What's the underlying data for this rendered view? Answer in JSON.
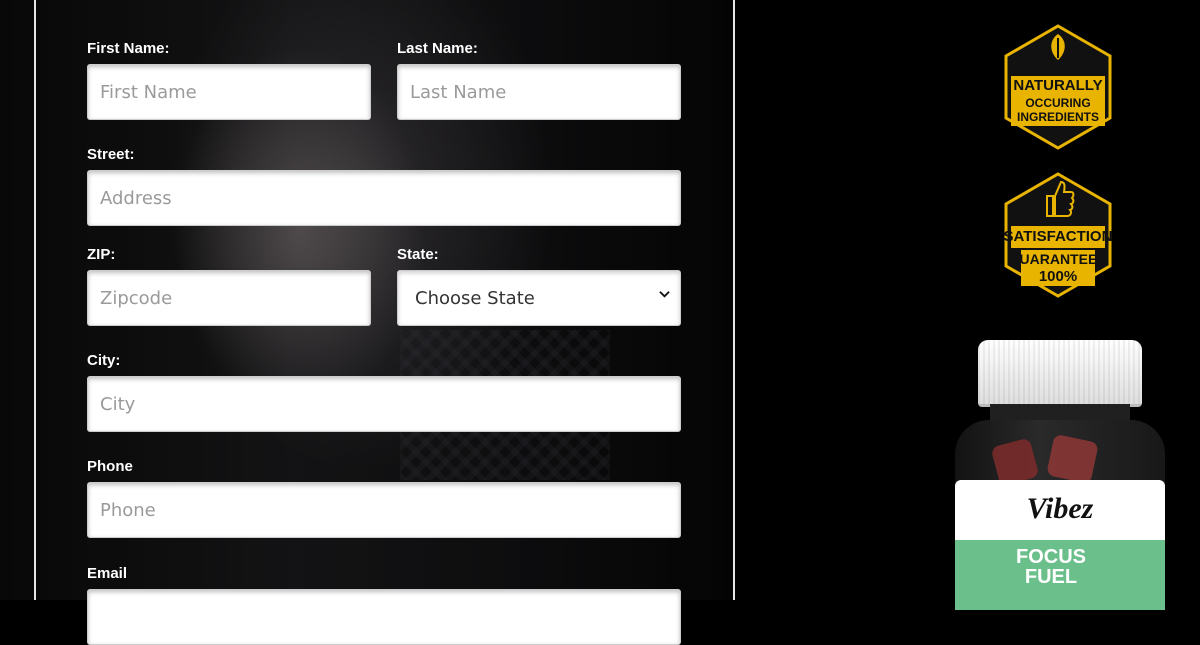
{
  "form": {
    "first_name_label": "First Name:",
    "first_name_placeholder": "First Name",
    "last_name_label": "Last Name:",
    "last_name_placeholder": "Last Name",
    "street_label": "Street:",
    "street_placeholder": "Address",
    "zip_label": "ZIP:",
    "zip_placeholder": "Zipcode",
    "state_label": "State:",
    "state_selected": "Choose State",
    "city_label": "City:",
    "city_placeholder": "City",
    "phone_label": "Phone",
    "phone_placeholder": "Phone",
    "email_label": "Email"
  },
  "badges": [
    {
      "line1": "NATURALLY",
      "line2": "OCCURING",
      "line3": "INGREDIENTS",
      "icon": "leaf-icon"
    },
    {
      "line1": "SATISFACTION",
      "line2": "GUARANTEED",
      "line3": "100%",
      "icon": "thumbs-up-icon"
    }
  ],
  "product": {
    "brand": "Vibez",
    "name_line1": "FOCUS",
    "name_line2": "FUEL"
  },
  "colors": {
    "badge_gold": "#e8b400",
    "badge_dark": "#111111",
    "label_green": "#6bbf8a"
  }
}
